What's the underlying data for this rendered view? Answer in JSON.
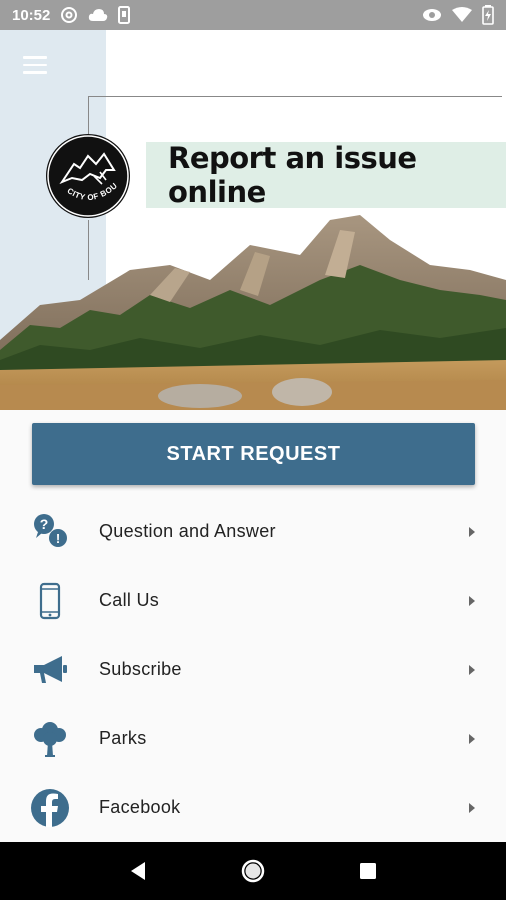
{
  "status_bar": {
    "time": "10:52",
    "icons_left": [
      "at-sign-icon",
      "cloud-icon",
      "phone-vibrate-icon"
    ],
    "icons_right": [
      "privacy-eye-icon",
      "wifi-icon",
      "battery-charging-icon"
    ]
  },
  "header": {
    "menu_icon": "hamburger-menu-icon",
    "logo_text": "CITY OF BOULDER",
    "banner_title": "Report an issue online"
  },
  "start_request": {
    "label": "START REQUEST"
  },
  "menu": {
    "items": [
      {
        "label": "Question and Answer",
        "icon": "question-answer-icon"
      },
      {
        "label": "Call Us",
        "icon": "phone-icon"
      },
      {
        "label": "Subscribe",
        "icon": "megaphone-icon"
      },
      {
        "label": "Parks",
        "icon": "tree-icon"
      },
      {
        "label": "Facebook",
        "icon": "facebook-icon"
      }
    ]
  },
  "nav_bar": {
    "buttons": [
      "back-icon",
      "home-icon",
      "recents-icon"
    ]
  },
  "colors": {
    "primary": "#3e6d8d",
    "banner_bg": "#dfeee6",
    "left_panel": "#dfe9f0",
    "status_bar": "#9e9e9e",
    "icon_color": "#3e6d8d"
  }
}
